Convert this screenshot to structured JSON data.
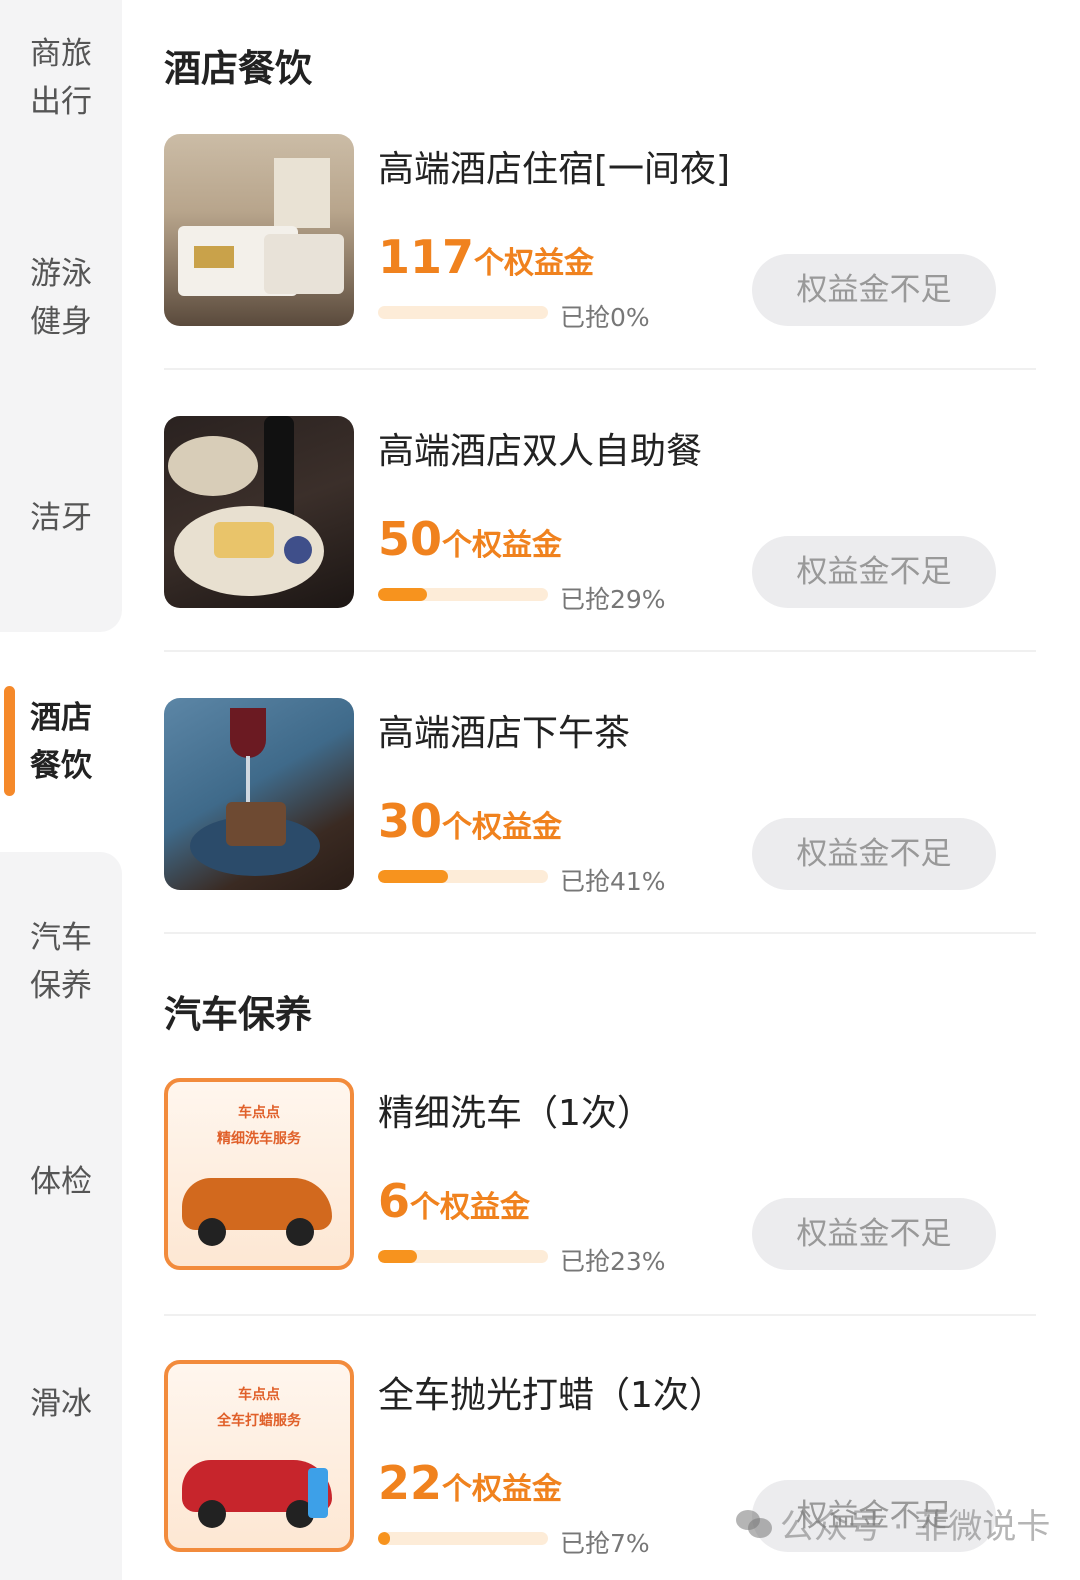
{
  "sidebar": {
    "items": [
      {
        "line1": "商旅",
        "line2": "出行",
        "active": false
      },
      {
        "line1": "游泳",
        "line2": "健身",
        "active": false
      },
      {
        "line1": "洁牙",
        "line2": "",
        "active": false
      },
      {
        "line1": "酒店",
        "line2": "餐饮",
        "active": true
      },
      {
        "line1": "汽车",
        "line2": "保养",
        "active": false
      },
      {
        "line1": "体检",
        "line2": "",
        "active": false
      },
      {
        "line1": "滑冰",
        "line2": "",
        "active": false
      }
    ],
    "accent_color": "#f5892a"
  },
  "sections": [
    {
      "title": "酒店餐饮",
      "items": [
        {
          "name": "高端酒店住宿[一间夜]",
          "price": "117",
          "unit": "个权益金",
          "progress_label": "已抢0%",
          "progress": 0,
          "button": "权益金不足",
          "thumb_icon": "hotel-room-image"
        },
        {
          "name": "高端酒店双人自助餐",
          "price": "50",
          "unit": "个权益金",
          "progress_label": "已抢29%",
          "progress": 0.29,
          "button": "权益金不足",
          "thumb_icon": "buffet-image"
        },
        {
          "name": "高端酒店下午茶",
          "price": "30",
          "unit": "个权益金",
          "progress_label": "已抢41%",
          "progress": 0.41,
          "button": "权益金不足",
          "thumb_icon": "afternoon-tea-image"
        }
      ]
    },
    {
      "title": "汽车保养",
      "items": [
        {
          "name": "精细洗车（1次）",
          "price": "6",
          "unit": "个权益金",
          "progress_label": "已抢23%",
          "progress": 0.23,
          "button": "权益金不足",
          "thumb_icon": "car-wash-image",
          "thumb_caption1": "车点点",
          "thumb_caption2": "精细洗车服务"
        },
        {
          "name": "全车抛光打蜡（1次）",
          "price": "22",
          "unit": "个权益金",
          "progress_label": "已抢7%",
          "progress": 0.07,
          "button": "权益金不足",
          "thumb_icon": "car-wax-image",
          "thumb_caption1": "车点点",
          "thumb_caption2": "全车打蜡服务"
        }
      ]
    }
  ],
  "watermark": {
    "text": "公众号 · 菲微说卡",
    "icon": "wechat-icon"
  },
  "colors": {
    "price": "#f0821e",
    "bar_track": "#fdecd8",
    "bar_fill": "#f7931e",
    "button_bg": "#ececee",
    "button_text": "#999999"
  }
}
